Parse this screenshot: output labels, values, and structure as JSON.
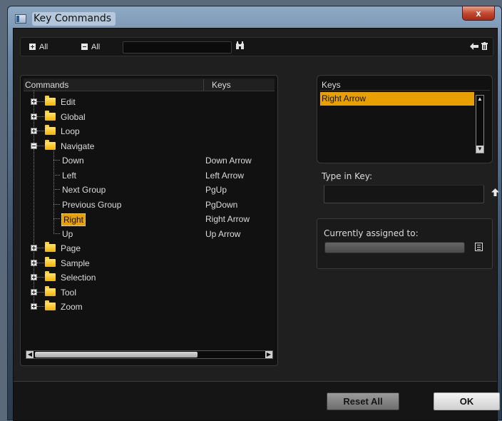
{
  "window": {
    "title": "Key Commands",
    "close_glyph": "x"
  },
  "toolbar": {
    "expand_all_label": "All",
    "collapse_all_label": "All",
    "search_value": "",
    "search_icon": "binoculars-icon",
    "assign_icon": "arrow-left-icon",
    "delete_icon": "trash-icon"
  },
  "commands": {
    "header_commands": "Commands",
    "header_keys": "Keys",
    "rows": [
      {
        "label": "Edit",
        "type": "folder",
        "expanded": false,
        "key": ""
      },
      {
        "label": "Global",
        "type": "folder",
        "expanded": false,
        "key": ""
      },
      {
        "label": "Loop",
        "type": "folder",
        "expanded": false,
        "key": ""
      },
      {
        "label": "Navigate",
        "type": "folder",
        "expanded": true,
        "key": ""
      },
      {
        "label": "Down",
        "type": "command",
        "key": "Down Arrow"
      },
      {
        "label": "Left",
        "type": "command",
        "key": "Left Arrow"
      },
      {
        "label": "Next Group",
        "type": "command",
        "key": "PgUp"
      },
      {
        "label": "Previous Group",
        "type": "command",
        "key": "PgDown"
      },
      {
        "label": "Right",
        "type": "command",
        "key": "Right Arrow",
        "selected": true
      },
      {
        "label": "Up",
        "type": "command",
        "key": "Up Arrow"
      },
      {
        "label": "Page",
        "type": "folder",
        "expanded": false,
        "key": ""
      },
      {
        "label": "Sample",
        "type": "folder",
        "expanded": false,
        "key": ""
      },
      {
        "label": "Selection",
        "type": "folder",
        "expanded": false,
        "key": ""
      },
      {
        "label": "Tool",
        "type": "folder",
        "expanded": false,
        "key": ""
      },
      {
        "label": "Zoom",
        "type": "folder",
        "expanded": false,
        "key": ""
      }
    ]
  },
  "keys_panel": {
    "header": "Keys",
    "items": [
      "Right Arrow"
    ]
  },
  "type_in_key": {
    "label": "Type in Key:",
    "value": ""
  },
  "assigned": {
    "label": "Currently assigned to:",
    "value": ""
  },
  "buttons": {
    "reset_all": "Reset All",
    "ok": "OK"
  },
  "colors": {
    "selection": "#e8a000",
    "folder": "#f2b400",
    "background": "#1f1f1f"
  }
}
